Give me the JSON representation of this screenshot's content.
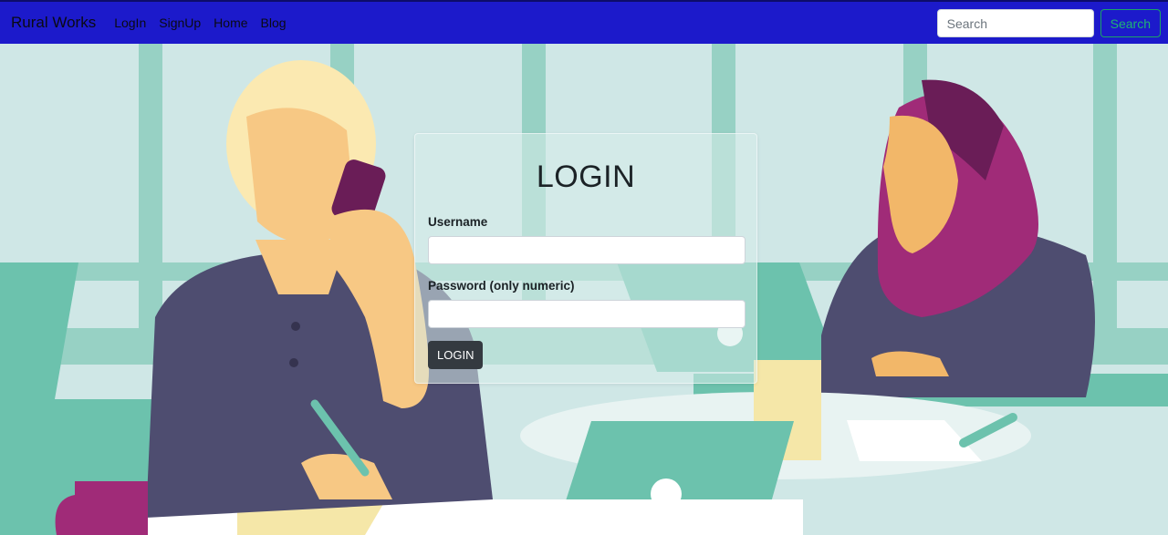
{
  "navbar": {
    "brand": "Rural Works",
    "links": [
      "LogIn",
      "SignUp",
      "Home",
      "Blog"
    ],
    "search": {
      "placeholder": "Search",
      "value": "",
      "button_label": "Search"
    },
    "bg_color": "#1c1acb"
  },
  "login": {
    "title": "LOGIN",
    "username_label": "Username",
    "username_value": "",
    "password_label": "Password (only numeric)",
    "password_value": "",
    "button_label": "LOGIN"
  },
  "background": {
    "illustration": "office-people-illustration",
    "colors": {
      "wall": "#cfe7e6",
      "stripe": "#97d1c4",
      "table": "#6cc2ad",
      "shirt": "#4e4d70",
      "skin": "#f7c884",
      "hijab": "#a02b78"
    }
  }
}
